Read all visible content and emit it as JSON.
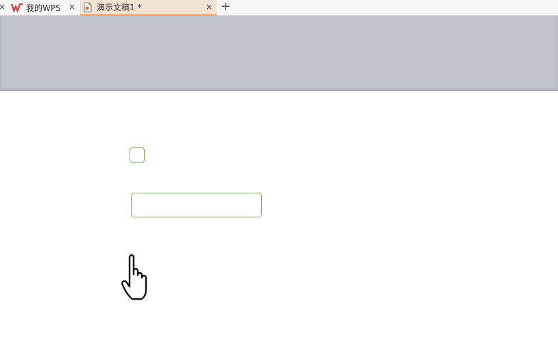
{
  "tabs": [
    {
      "label": "我的WPS",
      "icon": "wps-logo-icon",
      "active": false
    },
    {
      "label": "演示文稿1 *",
      "icon": "presentation-doc-icon",
      "active": true
    }
  ],
  "new_tab_symbol": "+",
  "close_symbol": "×",
  "colors": {
    "tab_active_bg": "#f3e3d3",
    "tab_active_border": "#e8a070",
    "ribbon_area": "#c0c3cb",
    "shape_outline": "#7fb15a",
    "wps_logo": "#d9413b"
  },
  "cursor": "hand-pointer"
}
